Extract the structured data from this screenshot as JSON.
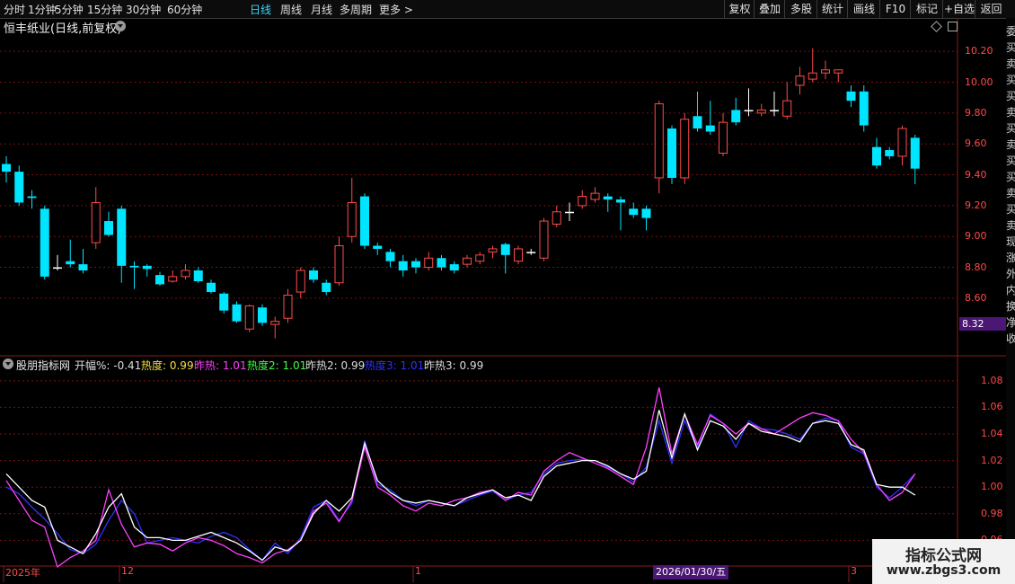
{
  "toolbar": {
    "timeframes": [
      "分时",
      "1分钟",
      "5分钟",
      "15分钟",
      "30分钟",
      "60分钟",
      "日线",
      "周线",
      "月线",
      "多周期",
      "更多 >"
    ],
    "active_timeframe": "日线",
    "buttons": [
      "复权",
      "叠加",
      "多股",
      "统计",
      "画线",
      "F10",
      "标记",
      "+自选",
      "返回"
    ]
  },
  "stock": {
    "title": "恒丰纸业(日线,前复权)"
  },
  "price_axis": {
    "labels": [
      "10.20",
      "10.00",
      "9.80",
      "9.60",
      "9.40",
      "9.20",
      "9.00",
      "8.80",
      "8.60"
    ],
    "current_price_tag": "8.32"
  },
  "indicator": {
    "name": "股朋指标网",
    "values": [
      {
        "label": "开幅%: -0.41",
        "color": "#dddddd"
      },
      {
        "label": "热度: 0.99",
        "color": "#f0e040"
      },
      {
        "label": "昨热: 1.01",
        "color": "#ff40ff"
      },
      {
        "label": "热度2: 1.01",
        "color": "#40ff40"
      },
      {
        "label": "昨热2: 0.99",
        "color": "#dddddd"
      },
      {
        "label": "热度3: 1.01",
        "color": "#3030ff"
      },
      {
        "label": "昨热3: 0.99",
        "color": "#dddddd"
      }
    ],
    "axis_labels": [
      "1.08",
      "1.06",
      "1.04",
      "1.02",
      "1.00",
      "0.98",
      "0.96"
    ]
  },
  "dates": {
    "labels": [
      "2025年",
      "12",
      "1",
      "3"
    ],
    "highlighted": "2026/01/30/五"
  },
  "right_strip_chars": "委买卖买买卖买卖买买卖买卖现涨外内换净收",
  "watermark": {
    "line1": "指标公式网",
    "line2": "www.zbgs3.com"
  },
  "colors": {
    "up": "#ff4a4a",
    "down": "#00e5ff",
    "doji": "#ffffff",
    "grid": "#7a1010"
  },
  "chart_data": {
    "type": "candlestick",
    "candles": [
      [
        9.47,
        9.42,
        9.52,
        9.35
      ],
      [
        9.42,
        9.22,
        9.46,
        9.2
      ],
      [
        9.26,
        9.25,
        9.3,
        9.18
      ],
      [
        9.18,
        8.74,
        9.2,
        8.72
      ],
      [
        8.8,
        8.8,
        8.88,
        8.78
      ],
      [
        8.84,
        8.82,
        8.98,
        8.8
      ],
      [
        8.82,
        8.78,
        8.92,
        8.76
      ],
      [
        8.96,
        9.22,
        9.32,
        8.92
      ],
      [
        9.1,
        9.01,
        9.16,
        9.0
      ],
      [
        9.18,
        8.81,
        9.2,
        8.7
      ],
      [
        8.81,
        8.8,
        8.84,
        8.66
      ],
      [
        8.81,
        8.79,
        8.82,
        8.74
      ],
      [
        8.75,
        8.69,
        8.77,
        8.68
      ],
      [
        8.71,
        8.74,
        8.78,
        8.7
      ],
      [
        8.74,
        8.78,
        8.82,
        8.72
      ],
      [
        8.78,
        8.71,
        8.8,
        8.7
      ],
      [
        8.7,
        8.64,
        8.72,
        8.63
      ],
      [
        8.63,
        8.52,
        8.64,
        8.5
      ],
      [
        8.56,
        8.45,
        8.58,
        8.44
      ],
      [
        8.4,
        8.55,
        8.56,
        8.38
      ],
      [
        8.54,
        8.44,
        8.56,
        8.42
      ],
      [
        8.43,
        8.45,
        8.48,
        8.34
      ],
      [
        8.47,
        8.62,
        8.66,
        8.44
      ],
      [
        8.64,
        8.78,
        8.8,
        8.6
      ],
      [
        8.78,
        8.72,
        8.8,
        8.7
      ],
      [
        8.7,
        8.64,
        8.72,
        8.62
      ],
      [
        8.7,
        8.94,
        9.0,
        8.68
      ],
      [
        9.0,
        9.22,
        9.38,
        8.96
      ],
      [
        9.26,
        8.94,
        9.28,
        8.92
      ],
      [
        8.94,
        8.92,
        8.96,
        8.88
      ],
      [
        8.9,
        8.84,
        8.92,
        8.8
      ],
      [
        8.84,
        8.78,
        8.88,
        8.74
      ],
      [
        8.84,
        8.8,
        8.86,
        8.76
      ],
      [
        8.8,
        8.86,
        8.9,
        8.78
      ],
      [
        8.86,
        8.8,
        8.88,
        8.78
      ],
      [
        8.82,
        8.78,
        8.84,
        8.76
      ],
      [
        8.82,
        8.86,
        8.88,
        8.8
      ],
      [
        8.84,
        8.88,
        8.9,
        8.82
      ],
      [
        8.9,
        8.92,
        8.94,
        8.86
      ],
      [
        8.95,
        8.88,
        8.96,
        8.76
      ],
      [
        8.84,
        8.92,
        8.94,
        8.82
      ],
      [
        8.9,
        8.9,
        8.92,
        8.88
      ],
      [
        8.86,
        9.1,
        9.12,
        8.84
      ],
      [
        9.08,
        9.16,
        9.2,
        9.06
      ],
      [
        9.16,
        9.16,
        9.22,
        9.1
      ],
      [
        9.2,
        9.26,
        9.3,
        9.18
      ],
      [
        9.24,
        9.28,
        9.32,
        9.22
      ],
      [
        9.26,
        9.24,
        9.28,
        9.16
      ],
      [
        9.24,
        9.22,
        9.26,
        9.04
      ],
      [
        9.18,
        9.14,
        9.22,
        9.12
      ],
      [
        9.18,
        9.12,
        9.2,
        9.04
      ],
      [
        9.38,
        9.86,
        9.88,
        9.28
      ],
      [
        9.7,
        9.38,
        9.72,
        9.34
      ],
      [
        9.38,
        9.76,
        9.8,
        9.34
      ],
      [
        9.78,
        9.7,
        9.94,
        9.68
      ],
      [
        9.72,
        9.68,
        9.88,
        9.66
      ],
      [
        9.54,
        9.74,
        9.8,
        9.52
      ],
      [
        9.82,
        9.74,
        9.9,
        9.72
      ],
      [
        9.82,
        9.82,
        9.96,
        9.78
      ],
      [
        9.8,
        9.82,
        9.86,
        9.78
      ],
      [
        9.82,
        9.82,
        9.94,
        9.78
      ],
      [
        9.78,
        9.88,
        10.0,
        9.76
      ],
      [
        9.98,
        10.04,
        10.1,
        9.92
      ],
      [
        10.02,
        10.06,
        10.22,
        10.0
      ],
      [
        10.06,
        10.08,
        10.14,
        10.02
      ],
      [
        10.06,
        10.08,
        10.08,
        10.0
      ],
      [
        9.94,
        9.88,
        9.98,
        9.84
      ],
      [
        9.94,
        9.72,
        9.98,
        9.68
      ],
      [
        9.58,
        9.46,
        9.64,
        9.44
      ],
      [
        9.56,
        9.52,
        9.58,
        9.5
      ],
      [
        9.52,
        9.7,
        9.72,
        9.46
      ],
      [
        9.64,
        9.44,
        9.66,
        9.34
      ]
    ],
    "ylim": [
      8.25,
      10.3
    ],
    "indicator_series": [
      {
        "name": "热度3",
        "color": "#3030ff",
        "values": [
          1.0,
          0.995,
          0.985,
          0.976,
          0.965,
          0.953,
          0.95,
          0.957,
          0.975,
          0.99,
          0.98,
          0.958,
          0.96,
          0.962,
          0.96,
          0.958,
          0.963,
          0.966,
          0.962,
          0.953,
          0.945,
          0.958,
          0.95,
          0.962,
          0.985,
          0.99,
          0.975,
          0.988,
          1.035,
          1.002,
          0.998,
          0.99,
          0.986,
          0.99,
          0.988,
          0.986,
          0.99,
          0.994,
          0.997,
          0.99,
          0.994,
          0.996,
          1.01,
          1.018,
          1.02,
          1.021,
          1.02,
          1.015,
          1.01,
          1.004,
          1.015,
          1.05,
          1.018,
          1.05,
          1.03,
          1.055,
          1.048,
          1.03,
          1.05,
          1.044,
          1.043,
          1.04,
          1.036,
          1.048,
          1.052,
          1.05,
          1.03,
          1.025,
          1.0,
          0.992,
          1.0,
          1.01
        ]
      },
      {
        "name": "昨热",
        "color": "#ff40ff",
        "values": [
          1.005,
          0.99,
          0.975,
          0.97,
          0.94,
          0.947,
          0.952,
          0.96,
          0.998,
          0.972,
          0.955,
          0.958,
          0.957,
          0.952,
          0.958,
          0.962,
          0.96,
          0.956,
          0.95,
          0.947,
          0.943,
          0.95,
          0.953,
          0.96,
          0.982,
          0.988,
          0.974,
          0.99,
          1.03,
          1.0,
          0.994,
          0.986,
          0.982,
          0.988,
          0.986,
          0.99,
          0.992,
          0.996,
          0.998,
          0.99,
          0.996,
          0.994,
          1.012,
          1.02,
          1.026,
          1.022,
          1.018,
          1.014,
          1.008,
          1.002,
          1.03,
          1.075,
          1.025,
          1.055,
          1.032,
          1.054,
          1.048,
          1.04,
          1.048,
          1.044,
          1.04,
          1.046,
          1.052,
          1.056,
          1.054,
          1.05,
          1.036,
          1.026,
          1.002,
          0.99,
          0.996,
          1.01
        ]
      },
      {
        "name": "昨热3",
        "color": "#ffffff",
        "values": [
          1.01,
          1.0,
          0.99,
          0.985,
          0.96,
          0.955,
          0.95,
          0.965,
          0.985,
          0.995,
          0.97,
          0.962,
          0.962,
          0.96,
          0.96,
          0.963,
          0.966,
          0.962,
          0.958,
          0.952,
          0.945,
          0.955,
          0.952,
          0.96,
          0.98,
          0.99,
          0.982,
          0.992,
          1.033,
          1.005,
          0.996,
          0.99,
          0.988,
          0.99,
          0.988,
          0.986,
          0.992,
          0.995,
          0.998,
          0.992,
          0.994,
          0.99,
          1.008,
          1.016,
          1.018,
          1.02,
          1.02,
          1.016,
          1.01,
          1.006,
          1.012,
          1.058,
          1.022,
          1.055,
          1.028,
          1.05,
          1.046,
          1.036,
          1.048,
          1.042,
          1.04,
          1.038,
          1.034,
          1.048,
          1.05,
          1.048,
          1.032,
          1.028,
          1.002,
          1.0,
          1.0,
          0.994
        ]
      }
    ],
    "indicator_ylim": [
      0.942,
      1.088
    ]
  }
}
